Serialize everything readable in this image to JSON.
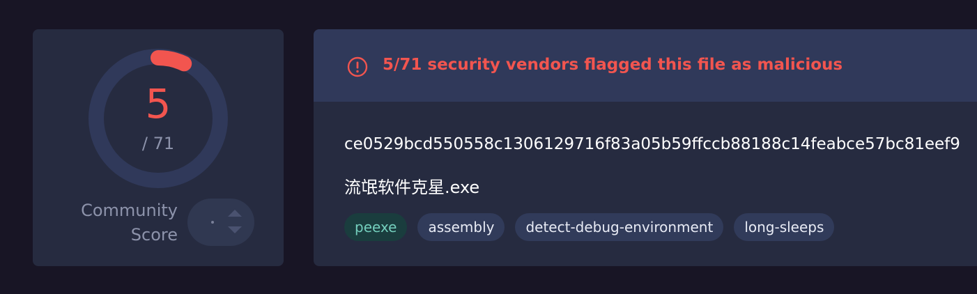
{
  "score": {
    "detected": "5",
    "total_label": "/ 71",
    "detected_fraction": 0.0704,
    "community_label_line1": "Community",
    "community_label_line2": "Score"
  },
  "detection": {
    "message": "5/71 security vendors flagged this file as malicious",
    "alert_icon": "exclamation-circle-icon"
  },
  "file": {
    "hash": "ce0529bcd550558c1306129716f83a05b59ffccb88188c14feabce57bc81eef9",
    "name": "流氓软件克星.exe"
  },
  "tags": [
    "peexe",
    "assembly",
    "detect-debug-environment",
    "long-sleeps"
  ],
  "colors": {
    "background": "#181525",
    "card": "#262b40",
    "header": "#30395a",
    "danger": "#f2554f",
    "muted": "#8d93ab",
    "filetype_tag_bg": "#1a3d3e",
    "filetype_tag_text": "#74cfbd"
  }
}
